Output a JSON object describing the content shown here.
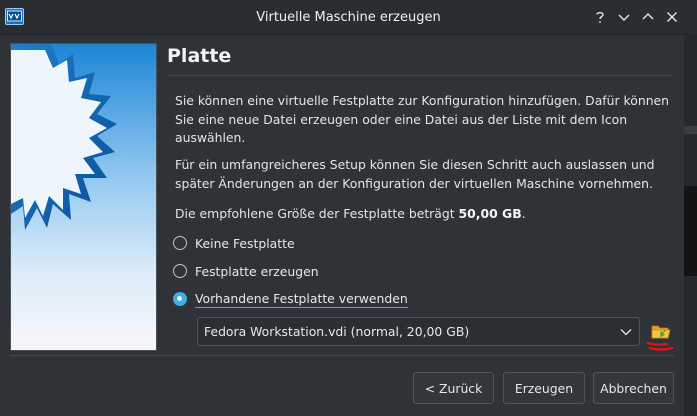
{
  "window": {
    "title": "Virtuelle Maschine erzeugen",
    "controls": [
      "help-icon",
      "minimize-icon",
      "maximize-icon",
      "close-icon"
    ]
  },
  "page": {
    "heading": "Platte",
    "para1": "Sie können eine virtuelle Festplatte zur Konfiguration hinzufügen. Dafür können Sie eine neue Datei erzeugen oder eine Datei aus der Liste mit dem Icon auswählen.",
    "para2": "Für ein umfangreicheres Setup können Sie diesen Schritt auch auslassen und später Änderungen an der Konfiguration der virtuellen Maschine vornehmen.",
    "recommend_prefix": "Die empfohlene Größe der Festplatte beträgt ",
    "recommend_value": "50,00 GB",
    "recommend_suffix": "."
  },
  "options": {
    "none": {
      "label": "Keine Festplatte",
      "checked": false
    },
    "create": {
      "label": "Festplatte erzeugen",
      "checked": false
    },
    "existing": {
      "label": "Vorhandene Festplatte verwenden",
      "checked": true
    }
  },
  "disk_select": {
    "value": "Fedora Workstation.vdi (normal, 20,00 GB)"
  },
  "buttons": {
    "back": "< Zurück",
    "create": "Erzeugen",
    "cancel": "Abbrechen"
  },
  "colors": {
    "accent": "#3daee9",
    "annotation": "#e0141b",
    "background": "#2f3338"
  }
}
